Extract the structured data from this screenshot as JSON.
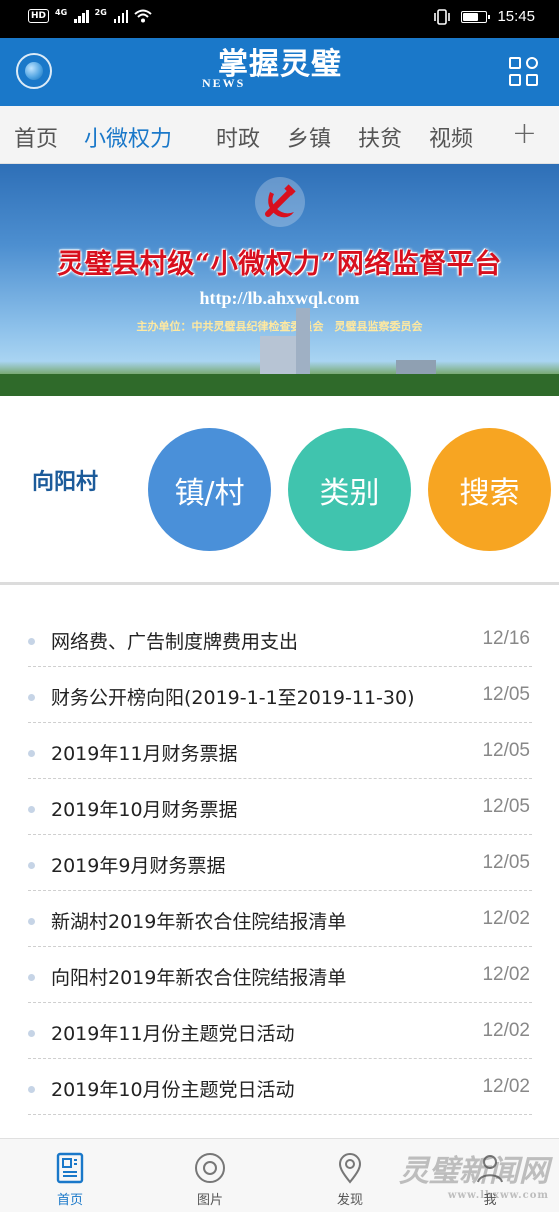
{
  "status_bar": {
    "hd_label": "HD",
    "network_1": "4G",
    "network_2": "2G",
    "time": "15:45",
    "battery_level": 0.7
  },
  "header": {
    "title": "掌握灵璧",
    "subtitle": "NEWS"
  },
  "tabs": [
    {
      "label": "首页",
      "active": false
    },
    {
      "label": "小微权力",
      "active": true
    },
    {
      "label": "时政",
      "active": false
    },
    {
      "label": "乡镇",
      "active": false
    },
    {
      "label": "扶贫",
      "active": false
    },
    {
      "label": "视频",
      "active": false
    }
  ],
  "tab_add_label": "+",
  "banner": {
    "title": "灵璧县村级“小微权力”网络监督平台",
    "url": "http://lb.ahxwql.com",
    "sponsor": "主办单位：中共灵璧县纪律检查委员会　灵璧县监察委员会"
  },
  "selector": {
    "village": "向阳村",
    "buttons": [
      {
        "label": "镇/村",
        "color": "#4a90d9"
      },
      {
        "label": "类别",
        "color": "#40c4ae"
      },
      {
        "label": "搜索",
        "color": "#f7a522"
      }
    ]
  },
  "news": [
    {
      "title": "网络费、广告制度牌费用支出",
      "date": "12/16"
    },
    {
      "title": "财务公开榜向阳(2019-1-1至2019-11-30)",
      "date": "12/05"
    },
    {
      "title": "2019年11月财务票据",
      "date": "12/05"
    },
    {
      "title": "2019年10月财务票据",
      "date": "12/05"
    },
    {
      "title": "2019年9月财务票据",
      "date": "12/05"
    },
    {
      "title": "新湖村2019年新农合住院结报清单",
      "date": "12/02"
    },
    {
      "title": "向阳村2019年新农合住院结报清单",
      "date": "12/02"
    },
    {
      "title": "2019年11月份主题党日活动",
      "date": "12/02"
    },
    {
      "title": "2019年10月份主题党日活动",
      "date": "12/02"
    }
  ],
  "bottom_nav": [
    {
      "label": "首页",
      "icon": "news-icon",
      "active": true
    },
    {
      "label": "图片",
      "icon": "camera-icon",
      "active": false
    },
    {
      "label": "发现",
      "icon": "location-icon",
      "active": false
    },
    {
      "label": "我",
      "icon": "user-icon",
      "active": false
    }
  ],
  "watermark": {
    "main": "灵璧新闻网",
    "url": "www.lbxww.com"
  },
  "colors": {
    "brand_blue": "#1a78c9",
    "active_tab": "#1a78c9",
    "village_label": "#1c5b9a"
  }
}
